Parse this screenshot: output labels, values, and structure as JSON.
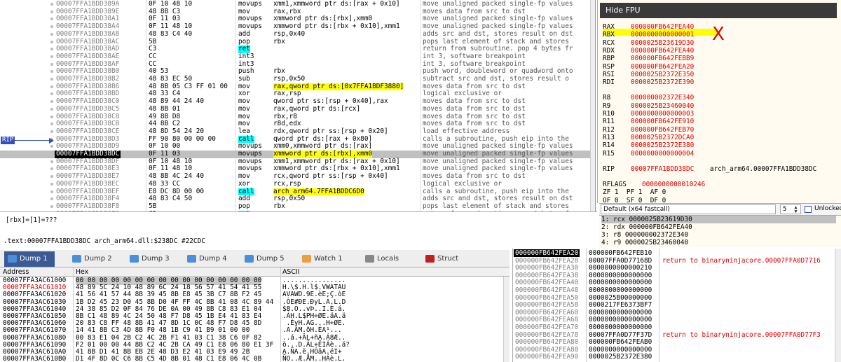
{
  "disasm": {
    "rows": [
      {
        "addr": "00007FFA1BDD389A",
        "bytes": "0F 10 48 10",
        "mnem": "movups",
        "ops": "xmm1,xmmword ptr ds:[rax + 0x10]",
        "cmt": "move unaligned packed single-fp values"
      },
      {
        "addr": "00007FFA1BDD389E",
        "bytes": "48 8B C3",
        "mnem": "mov",
        "ops": "rax,rbx",
        "cmt": "moves data from src to dst"
      },
      {
        "addr": "00007FFA1BDD38A1",
        "bytes": "0F 11 03",
        "mnem": "movups",
        "ops": "xmmword ptr ds:[rbx],xmm0",
        "cmt": "move unaligned packed single-fp values"
      },
      {
        "addr": "00007FFA1BDD38A4",
        "bytes": "0F 11 48 10",
        "mnem": "movups",
        "ops": "xmmword ptr ds:[rbx + 0x10],xmm1",
        "cmt": "move unaligned packed single-fp values"
      },
      {
        "addr": "00007FFA1BDD38A8",
        "bytes": "48 83 C4 40",
        "mnem": "add",
        "ops": "rsp,0x40",
        "cmt": "adds src and dst, stores result on dst"
      },
      {
        "addr": "00007FFA1BDD38AC",
        "bytes": "5B",
        "mnem": "pop",
        "ops": "rbx",
        "cmt": "pops last element of stack and stores"
      },
      {
        "addr": "00007FFA1BDD38AD",
        "bytes": "C3",
        "mnem": "ret",
        "ops": "",
        "cmt": "return from subroutine. pop 4 bytes fr"
      },
      {
        "addr": "00007FFA1BDD38AE",
        "bytes": "CC",
        "mnem": "int3",
        "ops": "",
        "cmt": "int 3, software breakpoint"
      },
      {
        "addr": "00007FFA1BDD38AF",
        "bytes": "CC",
        "mnem": "int3",
        "ops": "",
        "cmt": "int 3, software breakpoint"
      },
      {
        "addr": "00007FFA1BDD38B0",
        "bytes": "40 53",
        "mnem": "push",
        "ops": "rbx",
        "cmt": "push word, doubleword or quadword onto"
      },
      {
        "addr": "00007FFA1BDD38B2",
        "bytes": "48 83 EC 50",
        "mnem": "sub",
        "ops": "rsp,0x50",
        "cmt": "subtract src and dst, stores result o"
      },
      {
        "addr": "00007FFA1BDD38B6",
        "bytes": "48 8B 05 C3 FF 01 00",
        "mnem": "mov",
        "ops": "rax,qword ptr ds:[0x7FFA1BDF3880]",
        "cmt": "moves data from src to dst"
      },
      {
        "addr": "00007FFA1BDD38BD",
        "bytes": "48 33 C4",
        "mnem": "xor",
        "ops": "rax,rsp",
        "cmt": "logical exclusive or"
      },
      {
        "addr": "00007FFA1BDD38C0",
        "bytes": "48 89 44 24 40",
        "mnem": "mov",
        "ops": "qword ptr ss:[rsp + 0x40],rax",
        "cmt": "moves data from src to dst"
      },
      {
        "addr": "00007FFA1BDD38C5",
        "bytes": "48 8B 01",
        "mnem": "mov",
        "ops": "rax,qword ptr ds:[rcx]",
        "cmt": "moves data from src to dst"
      },
      {
        "addr": "00007FFA1BDD38C8",
        "bytes": "49 8B D8",
        "mnem": "mov",
        "ops": "rbx,r8",
        "cmt": "moves data from src to dst"
      },
      {
        "addr": "00007FFA1BDD38CB",
        "bytes": "44 8B C2",
        "mnem": "mov",
        "ops": "r8d,edx",
        "cmt": "moves data from src to dst"
      },
      {
        "addr": "00007FFA1BDD38CE",
        "bytes": "48 8D 54 24 20",
        "mnem": "lea",
        "ops": "rdx,qword ptr ss:[rsp + 0x20]",
        "cmt": "load effective address"
      },
      {
        "addr": "00007FFA1BDD38D3",
        "bytes": "FF 90 80 00 00 00",
        "mnem": "call",
        "ops": "qword ptr ds:[rax + 0x80]",
        "cmt": "calls a subroutine, push eip into the"
      },
      {
        "addr": "00007FFA1BDD38D9",
        "bytes": "0F 10 00",
        "mnem": "movups",
        "ops": "xmm0,xmmword ptr ds:[rax]",
        "cmt": "move unaligned packed single-fp values"
      },
      {
        "addr": "00007FFA1BDD38DC",
        "bytes": "0F 11 03",
        "mnem": "movups",
        "ops": "xmmword ptr ds:[rbx],xmm0",
        "cmt": "move unaligned packed single-fp values"
      },
      {
        "addr": "00007FFA1BDD38DF",
        "bytes": "0F 10 48 10",
        "mnem": "movups",
        "ops": "xmm1,xmmword ptr ds:[rax + 0x10]",
        "cmt": "move unaligned packed single-fp values"
      },
      {
        "addr": "00007FFA1BDD38E3",
        "bytes": "0F 11 48 10",
        "mnem": "movups",
        "ops": "xmmword ptr ds:[rbx + 0x10],xmm1",
        "cmt": "move unaligned packed single-fp values"
      },
      {
        "addr": "00007FFA1BDD38E7",
        "bytes": "48 8B 4C 24 40",
        "mnem": "mov",
        "ops": "rcx,qword ptr ss:[rsp + 0x40]",
        "cmt": "moves data from src to dst"
      },
      {
        "addr": "00007FFA1BDD38EC",
        "bytes": "48 33 CC",
        "mnem": "xor",
        "ops": "rcx,rsp",
        "cmt": "logical exclusive or"
      },
      {
        "addr": "00007FFA1BDD38EF",
        "bytes": "E8 DC 8D 00 00",
        "mnem": "call",
        "ops": "arch_arm64.7FFA1BDDC6D0",
        "cmt": "calls a subroutine, push eip into the"
      },
      {
        "addr": "00007FFA1BDD38F4",
        "bytes": "48 83 C4 50",
        "mnem": "add",
        "ops": "rsp,0x50",
        "cmt": "adds src and dst, stores result on dst"
      },
      {
        "addr": "00007FFA1BDD38F8",
        "bytes": "5B",
        "mnem": "pop",
        "ops": "rbx",
        "cmt": "pops last element of stack and stores"
      },
      {
        "addr": "00007FFA1BDD38F9",
        "bytes": "C3",
        "mnem": "ret",
        "ops": "",
        "cmt": "return from subroutine. pop 4 bytes fr"
      },
      {
        "addr": "00007FFA1BDD38FA",
        "bytes": "CC",
        "mnem": "int3",
        "ops": "",
        "cmt": "int 3, software breakpoint"
      },
      {
        "addr": "00007FFA1BDD38FB",
        "bytes": "CC",
        "mnem": "int3",
        "ops": "",
        "cmt": "int 3, software breakpoint"
      },
      {
        "addr": "00007FFA1BDD38FC",
        "bytes": "CC",
        "mnem": "int3",
        "ops": "",
        "cmt": "int 3, software breakpoint"
      }
    ],
    "rip_label": "RIP",
    "current_index": 20
  },
  "info": {
    "line1": "[rbx]=[1]=???",
    "line2": ".text:00007FFA1BDD38DC arch_arm64.dll:$238DC #22CDC"
  },
  "registers": {
    "hide_fpu_label": "Hide FPU",
    "gprs": [
      {
        "name": "RAX",
        "value": "000000FB642FEA40"
      },
      {
        "name": "RBX",
        "value": "0000000000000001"
      },
      {
        "name": "RCX",
        "value": "0000025B23619D30"
      },
      {
        "name": "RDX",
        "value": "000000FB642FEA40"
      },
      {
        "name": "RBP",
        "value": "000000FB642FEBB9"
      },
      {
        "name": "RSP",
        "value": "000000FB642FEA20"
      },
      {
        "name": "RSI",
        "value": "0000025B2372E350"
      },
      {
        "name": "RDI",
        "value": "0000025B2372E390"
      }
    ],
    "ext": [
      {
        "name": "R8",
        "value": "000000002372E340"
      },
      {
        "name": "R9",
        "value": "0000025B23460040"
      },
      {
        "name": "R10",
        "value": "0000000000000003"
      },
      {
        "name": "R11",
        "value": "000000FB642FE910"
      },
      {
        "name": "R12",
        "value": "000000FB642FEB70"
      },
      {
        "name": "R13",
        "value": "0000025B2372DCA0"
      },
      {
        "name": "R14",
        "value": "0000025B2372E380"
      },
      {
        "name": "R15",
        "value": "0000000000000004"
      }
    ],
    "rip": {
      "name": "RIP",
      "value": "00007FFA1BDD38DC",
      "label": "arch_arm64.00007FFA1BDD38DC"
    },
    "rflags": {
      "name": "RFLAGS",
      "value": "0000000000010246"
    },
    "flags_line1": "ZF 1  PF 1  AF 0",
    "flags_line2": "OF 0  SF 0  DF 0",
    "annotation_mark": "X"
  },
  "callconv": {
    "selected": "Default (x64 fastcall)",
    "count": "5",
    "unlocked_label": "Unlocked",
    "args": [
      "1: rcx 0000025B23619D30",
      "2: rdx 000000FB642FEA40",
      "3: r8 000000002372E340",
      "4: r9 0000025B23460040"
    ]
  },
  "tabs": [
    {
      "label": "Dump 1",
      "icon": "dump-icon",
      "active": true
    },
    {
      "label": "Dump 2",
      "icon": "dump-icon"
    },
    {
      "label": "Dump 3",
      "icon": "dump-icon"
    },
    {
      "label": "Dump 4",
      "icon": "dump-icon"
    },
    {
      "label": "Dump 5",
      "icon": "dump-icon"
    },
    {
      "label": "Watch 1",
      "icon": "watch-icon"
    },
    {
      "label": "Locals",
      "icon": "locals-icon"
    },
    {
      "label": "Struct",
      "icon": "struct-icon"
    }
  ],
  "dump": {
    "headers": {
      "address": "Address",
      "hex": "Hex",
      "ascii": "ASCII"
    },
    "rows": [
      {
        "addr": "00007FFA3AC61000",
        "hex": "00 00 00 00 00 00 00 00 00 00 00 00 00 00 00 00",
        "ascii": "................"
      },
      {
        "addr": "00007FFA3AC61010",
        "hex": "48 89 5C 24 10 48 89 6C 24 18 56 57 41 54 41 55",
        "ascii": "H.\\$.H.l$.VWATAU"
      },
      {
        "addr": "00007FFA3AC61020",
        "hex": "41 56 41 57 44 8B 39 45 8B E8 45 3B C7 8B F2 45",
        "ascii": "AVAWD.9E.èE;Ç.òE"
      },
      {
        "addr": "00007FFA3AC61030",
        "hex": "1B D2 45 23 D0 45 8B D0 4F FF 4C 8B 41 08 4C 89 44",
        "ascii": ".ÒE#ÐE.ÐyL.A.L.D"
      },
      {
        "addr": "00007FFA3AC61040",
        "hex": "24 38 85 D2 0F 84 76 DE 0A 00 49 8B C8 83 E1 04",
        "ascii": "$8.Ò..vÞ..I.È.á."
      },
      {
        "addr": "00007FFA3AC61050",
        "hex": "8B C1 48 89 4C 24 50 48 F7 D8 45 1B E4 41 83 E4",
        "ascii": ".ÁH.L$PH÷ØE.äA.ä"
      },
      {
        "addr": "00007FFA3AC61060",
        "hex": "20 83 C8 FF 48 8B 41 47 8D 1C 0C 48 F7 D8 45 8D",
        "ascii": " .ÈyH.AG...H÷ØE."
      },
      {
        "addr": "00007FFA3AC61070",
        "hex": "14 41 8B C3 4D 8B F0 48 1B C9 41 B9 01 00 00",
        "ascii": ".A.ÃM.ðH.ÉA¹..."
      },
      {
        "addr": "00007FFA3AC61080",
        "hex": "00 83 E1 04 2B C2 4C 2B F1 41 03 C1 38 C6 0F 82",
        "ascii": "..á.+ÂL+ñA.Á8Æ.."
      },
      {
        "addr": "00007FFA3AC61090",
        "hex": "F2 01 00 00 44 8B C2 4C 2B CA 49 C1 E8 06 80 E1 3F",
        "ascii": "ò...D.ÂL+ÊIÁè..á?"
      },
      {
        "addr": "00007FFA3AC610A0",
        "hex": "41 8B D1 41 8B EB 2E 48 D3 E2 41 03 E9 49 2B",
        "ascii": "A.ÑA.ë.HÓâA.éI+"
      },
      {
        "addr": "00007FFA3AC610B0",
        "hex": "D1 4F 8D 0C C6 8B C5 4D 8B 01 48 C1 E8 06 4C 0B",
        "ascii": "ÑO..Æ.ÅM..HÁè.L."
      }
    ]
  },
  "stack": {
    "rows": [
      {
        "addr": "000000FB642FEA20",
        "val": "000000FB642FEB10",
        "cmt": "",
        "current": true
      },
      {
        "addr": "000000FB642FEA28",
        "val": "00007FFA0D77168D",
        "cmt": "return to binaryninjacore.00007FFA0D7716"
      },
      {
        "addr": "000000FB642FEA30",
        "val": "0000000000000210",
        "cmt": ""
      },
      {
        "addr": "000000FB642FEA38",
        "val": "0000000000000000",
        "cmt": ""
      },
      {
        "addr": "000000FB642FEA40",
        "val": "0000000000000000",
        "cmt": ""
      },
      {
        "addr": "000000FB642FEA48",
        "val": "0000000000000000",
        "cmt": ""
      },
      {
        "addr": "000000FB642FEA50",
        "val": "0000025B00000000",
        "cmt": ""
      },
      {
        "addr": "000000FB642FEA58",
        "val": "0000217FE6373BF7",
        "cmt": ""
      },
      {
        "addr": "000000FB642FEA60",
        "val": "0000000000000000",
        "cmt": ""
      },
      {
        "addr": "000000FB642FEA68",
        "val": "0000000000000000",
        "cmt": ""
      },
      {
        "addr": "000000FB642FEA70",
        "val": "0000000000000000",
        "cmt": ""
      },
      {
        "addr": "000000FB642FEA78",
        "val": "00007FFA0D77F37D",
        "cmt": "return to binaryninjacore.00007FFA0D77F3"
      },
      {
        "addr": "000000FB642FEA80",
        "val": "000000FB642FEAB0",
        "cmt": ""
      },
      {
        "addr": "000000FB642FEA88",
        "val": "0000000000000000",
        "cmt": ""
      },
      {
        "addr": "000000FB642FEA90",
        "val": "0000025B2372E380",
        "cmt": ""
      }
    ]
  }
}
